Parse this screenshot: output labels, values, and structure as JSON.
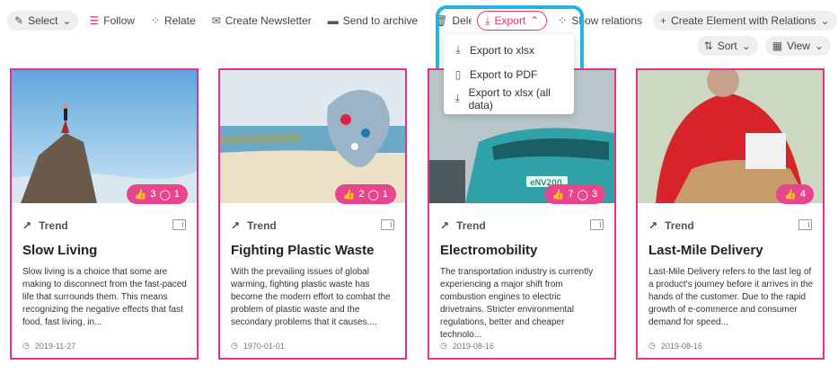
{
  "toolbar": {
    "select": "Select",
    "follow": "Follow",
    "relate": "Relate",
    "create_newsletter": "Create Newsletter",
    "send_to_archive": "Send to archive",
    "delete": "Delete",
    "export": "Export",
    "show_relations": "Show relations",
    "create_element": "Create Element with Relations",
    "sort": "Sort",
    "view": "View"
  },
  "export_menu": [
    {
      "label": "Export to xlsx"
    },
    {
      "label": "Export to PDF"
    },
    {
      "label": "Export to xlsx (all data)"
    }
  ],
  "cards": [
    {
      "type": "Trend",
      "title": "Slow Living",
      "likes": "3",
      "comments": "1",
      "date": "2019-11-27",
      "description": "Slow living is a choice that some are making to disconnect from the fast-paced life that surrounds them. This means recognizing the negative effects that fast food, fast living, in..."
    },
    {
      "type": "Trend",
      "title": "Fighting Plastic Waste",
      "likes": "2",
      "comments": "1",
      "date": "1970-01-01",
      "description": "With the prevailing issues of global warming, fighting plastic waste has become the modern effort to combat the problem of plastic waste and the secondary problems that it causes...."
    },
    {
      "type": "Trend",
      "title": "Electromobility",
      "likes": "7",
      "comments": "3",
      "date": "2019-08-16",
      "description": "The transportation industry is currently experiencing a major shift from combustion engines to electric drivetrains. Stricter environmental regulations, better and cheaper technolo..."
    },
    {
      "type": "Trend",
      "title": "Last-Mile Delivery",
      "likes": "4",
      "comments": "",
      "date": "2019-08-16",
      "description": "Last-Mile Delivery refers to the last leg of a product's journey before it arrives in the hands of the customer. Due to the rapid growth of e-commerce and consumer demand for speed..."
    }
  ],
  "colors": {
    "accent": "#e3338f",
    "highlight": "#21b5e0"
  }
}
